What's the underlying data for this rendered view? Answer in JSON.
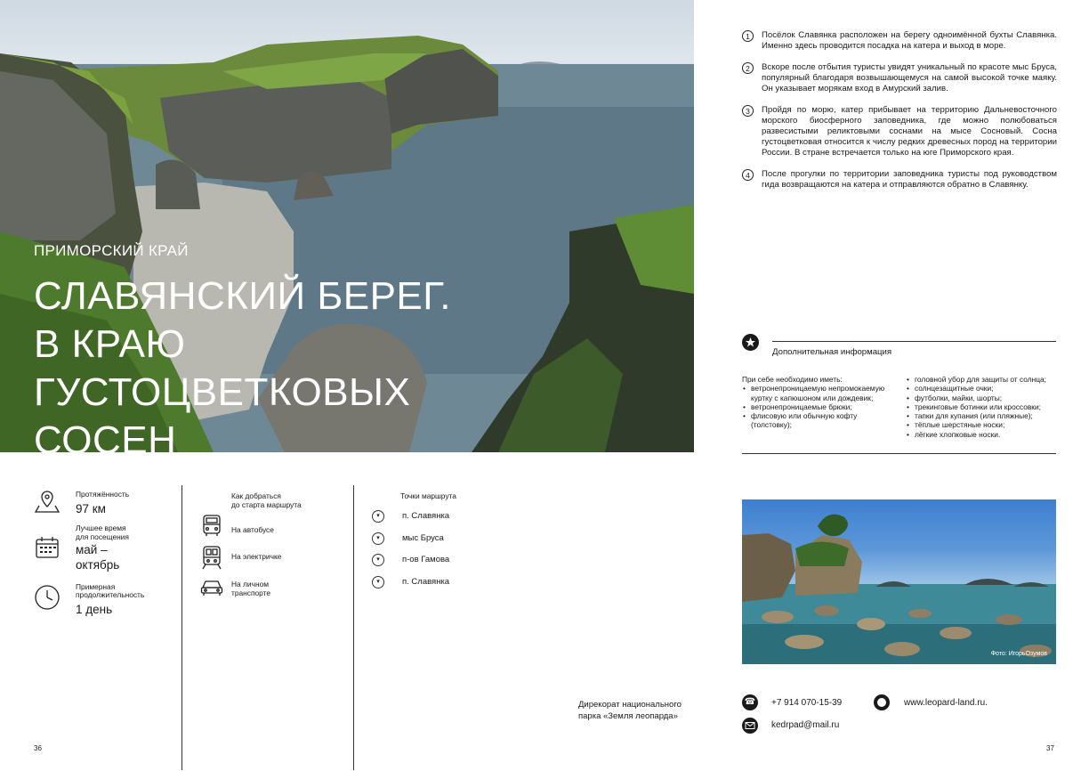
{
  "hero": {
    "region": "ПРИМОРСКИЙ КРАЙ",
    "title_lines": [
      "СЛАВЯНСКИЙ БЕРЕГ.",
      "В КРАЮ",
      "ГУСТОЦВЕТКОВЫХ",
      "СОСЕН"
    ]
  },
  "steps": [
    {
      "num": "1",
      "text": "Посёлок Славянка расположен на берегу одноимённой бухты Славянка. Именно здесь проводится посадка на катера и выход в море."
    },
    {
      "num": "2",
      "text": "Вскоре после отбытия туристы увидят уникальный по красоте мыс Бруса, популярный благодаря возвышающемуся на самой высокой точке маяку. Он указывает морякам вход в Амурский залив."
    },
    {
      "num": "3",
      "text": "Пройдя по морю, катер прибывает на территорию Дальневосточного морского биосферного заповедника, где можно полюбоваться развесистыми реликтовыми соснами на мысе Сосновый. Сосна густоцветковая относится к числу редких древесных пород на территории России. В стране встречается только на юге Приморского края."
    },
    {
      "num": "4",
      "text": "После прогулки по территории заповедника туристы под руководством гида возвращаются на катера и отправляются обратно в Славянку."
    }
  ],
  "info": {
    "title": "Дополнительная информация",
    "need_title": "При себе необходимо иметь:",
    "col1": [
      "ветронепроницаемую непромокаемую куртку с капюшоном или дождевик;",
      "ветронепроницаемые брюки;",
      "флисовую или обычную кофту (толстовку);"
    ],
    "col2": [
      "головной убор для защиты от солнца;",
      "солнцезащитные очки;",
      "футболки, майки, шорты;",
      "трекинговые ботинки или кроссовки;",
      "тапки для купания (или пляжные);",
      "тёплые шерстяные носки;",
      "лёгкие хлопковые носки."
    ]
  },
  "stats": {
    "length_label": "Протяжённость",
    "length_value": "97 км",
    "season_label1": "Лучшее время",
    "season_label2": "для посещения",
    "season_value1": "май –",
    "season_value2": "октябрь",
    "duration_label1": "Примерная",
    "duration_label2": "продолжительность",
    "duration_value": "1 день"
  },
  "transport": {
    "label1": "Как добраться",
    "label2": "до старта маршрута",
    "bus": "На автобусе",
    "train": "На электричке",
    "car1": "На личном",
    "car2": "транспорте"
  },
  "route": {
    "label": "Точки маршрута",
    "points": [
      "п. Славянка",
      "мыс Бруса",
      "п-ов Гамова",
      "п. Славянка"
    ]
  },
  "contacts": {
    "org1": "Дирекорат национального",
    "org2": "парка «Земля леопарда»",
    "phone": "+7 914 070-15-39",
    "email": "kedrpad@mail.ru",
    "site": "www.leopard-land.ru."
  },
  "photo_credit": "Фото: ИгорьОзумов",
  "pages": {
    "left": "36",
    "right": "37"
  }
}
